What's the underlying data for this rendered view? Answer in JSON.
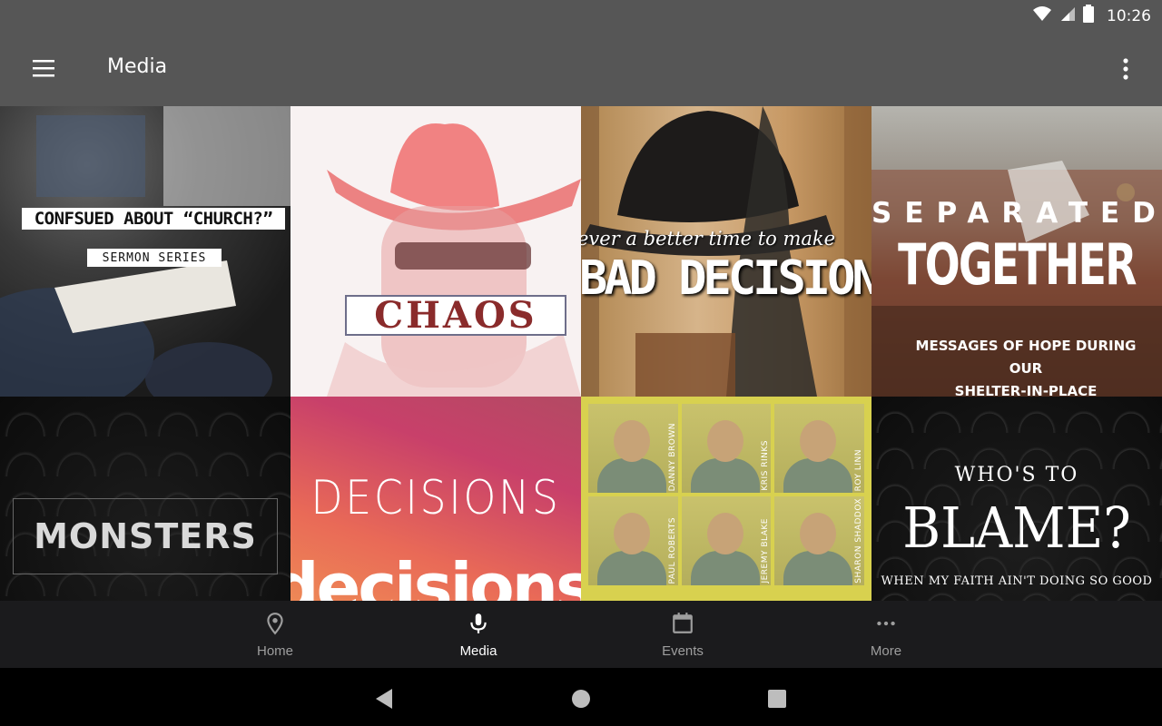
{
  "status": {
    "time": "10:26"
  },
  "appbar": {
    "title": "Media"
  },
  "tiles": [
    {
      "line1": "CONFSUED ABOUT “CHURCH?”",
      "line2": "SERMON SERIES"
    },
    {
      "line1": "CHAOS"
    },
    {
      "line1": "ever a better time to make",
      "line2": "BAD DECISION"
    },
    {
      "line1": "SEPARATED",
      "line2": "TOGETHER",
      "line3": "MESSAGES OF HOPE DURING OUR",
      "line4": "SHELTER-IN-PLACE"
    },
    {
      "line1": "MONSTERS"
    },
    {
      "line1": "DECISIONS",
      "line2": "decisions"
    },
    {
      "names": [
        "DANNY BROWN",
        "KRIS RINKS",
        "ROY LINN",
        "PAUL ROBERTS",
        "JEREMY BLAKE",
        "SHARON SHADDOX"
      ]
    },
    {
      "line1": "WHO'S TO",
      "line2": "BLAME?",
      "line3": "WHEN MY FAITH AIN'T DOING SO GOOD"
    }
  ],
  "nav": {
    "items": [
      {
        "label": "Home",
        "icon": "location-pin-icon"
      },
      {
        "label": "Media",
        "icon": "microphone-icon"
      },
      {
        "label": "Events",
        "icon": "calendar-icon"
      },
      {
        "label": "More",
        "icon": "more-horizontal-icon"
      }
    ],
    "active": "Media"
  },
  "colors": {
    "appbar": "#565656",
    "bottom_nav": "#1b1b1d",
    "nav_inactive": "#9e9e9e",
    "nav_active": "#ffffff"
  }
}
